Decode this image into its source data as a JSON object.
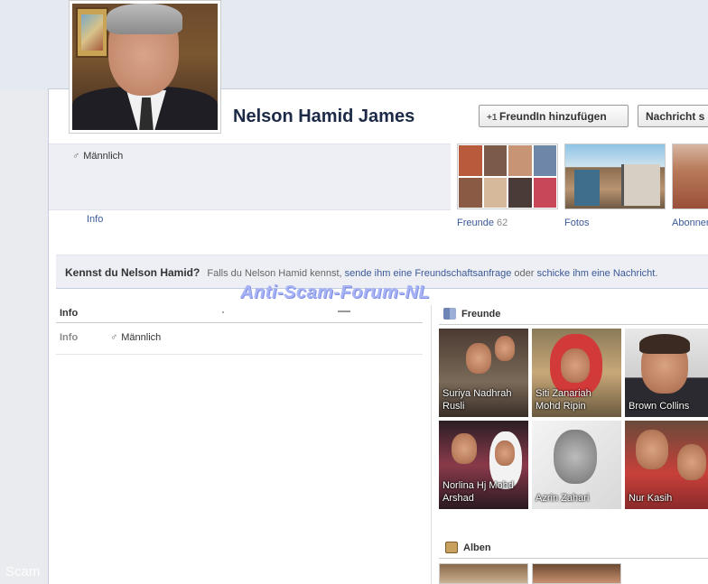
{
  "profile": {
    "name": "Nelson Hamid James",
    "gender": "Männlich",
    "gender_symbol": "♂"
  },
  "actions": {
    "add_friend": "FreundIn hinzufügen",
    "add_friend_icon": "add-friend-icon",
    "message": "Nachricht s"
  },
  "nav": {
    "info_tab": "Info"
  },
  "thumbs": {
    "friends_label": "Freunde",
    "friends_count": "62",
    "photos_label": "Fotos",
    "subscribers_label": "Abonnen"
  },
  "know_box": {
    "title": "Kennst du Nelson Hamid?",
    "text_prefix": "Falls du Nelson Hamid kennst,",
    "link_request": "sende ihm eine Freundschaftsanfrage",
    "text_or": "oder",
    "link_message": "schicke ihm eine Nachricht",
    "text_end": "."
  },
  "watermark": "Anti-Scam-Forum-NL",
  "side_watermark": "Scam",
  "info_section": {
    "header": "Info",
    "row_label": "Info",
    "row_value": "Männlich"
  },
  "friends_section": {
    "title": "Freunde",
    "friends": [
      {
        "name": "Suriya Nadhrah Rusli"
      },
      {
        "name": "Siti Zanariah Mohd Ripin"
      },
      {
        "name": "Brown Collins"
      },
      {
        "name": "Norlina Hj Mohd Arshad"
      },
      {
        "name": "Azrin Zahari"
      },
      {
        "name": "Nur Kasih"
      }
    ]
  },
  "albums_section": {
    "title": "Alben"
  },
  "colors": {
    "link": "#3b5998",
    "name": "#1c2a47",
    "strip_bg": "#edeff4",
    "watermark": "#a8b4f4"
  }
}
